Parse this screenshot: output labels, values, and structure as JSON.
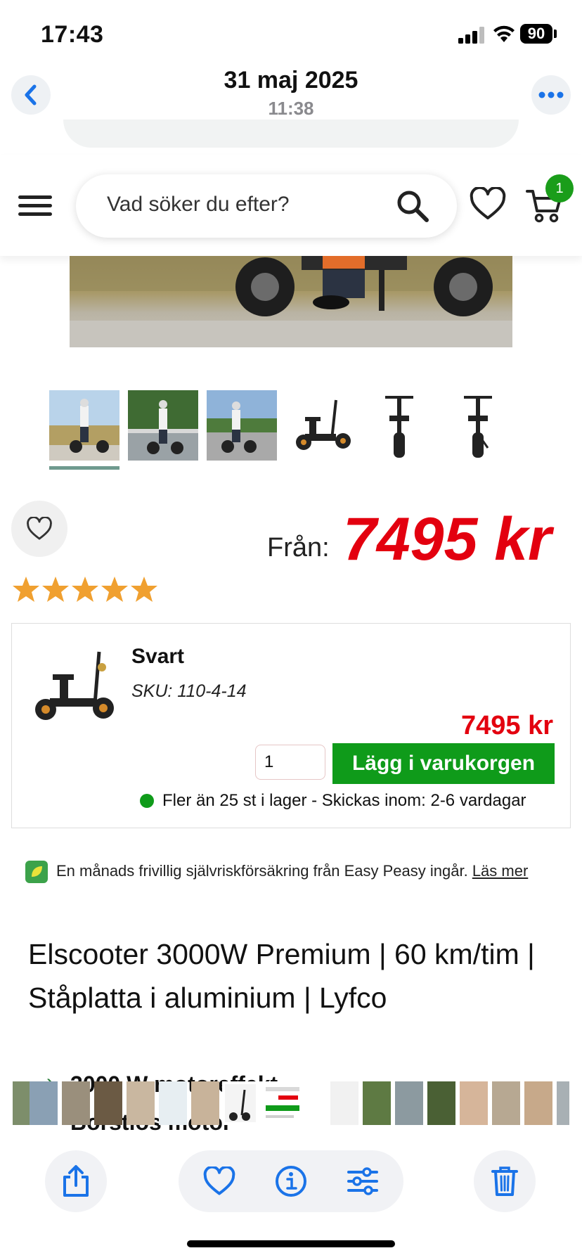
{
  "status_bar": {
    "time": "17:43",
    "battery": "90",
    "icons": [
      "signal-icon",
      "wifi-icon",
      "battery-icon"
    ]
  },
  "photo_viewer": {
    "date": "31 maj 2025",
    "time": "11:38",
    "icons": {
      "back": "chevron-left-icon",
      "more": "ellipsis-icon"
    }
  },
  "site_header": {
    "search_placeholder": "Vad söker du efter?",
    "cart_count": "1",
    "icons": [
      "menu-icon",
      "search-icon",
      "heart-icon",
      "cart-icon"
    ]
  },
  "gallery": {
    "thumbnails": [
      "thumb-1",
      "thumb-2",
      "thumb-3",
      "thumb-4",
      "thumb-5",
      "thumb-6"
    ],
    "active_index": 0
  },
  "product": {
    "from_label": "Från:",
    "price": "7495 kr",
    "rating_stars": 5,
    "title": "Elscooter 3000W Premium | 60 km/tim | Ståplatta i aluminium | Lyfco"
  },
  "variant": {
    "name": "Svart",
    "sku": "SKU: 110-4-14",
    "price": "7495 kr",
    "quantity": "1",
    "add_to_cart_label": "Lägg i varukorgen",
    "stock_text": "Fler än 25 st i lager - Skickas inom: 2-6 vardagar"
  },
  "insurance": {
    "text": "En månads frivillig självriskförsäkring från Easy Peasy ingår.",
    "link": "Läs mer"
  },
  "features": {
    "items": [
      "3000 W motoreffekt",
      "Borstlös motor"
    ]
  },
  "toolbar": {
    "icons": [
      "share-icon",
      "heart-icon",
      "info-icon",
      "adjust-icon",
      "trash-icon"
    ]
  },
  "colors": {
    "price_red": "#e3000f",
    "cta_green": "#0f9b1a",
    "ios_blue": "#1a73e8",
    "badge_green": "#1a9d1a"
  }
}
